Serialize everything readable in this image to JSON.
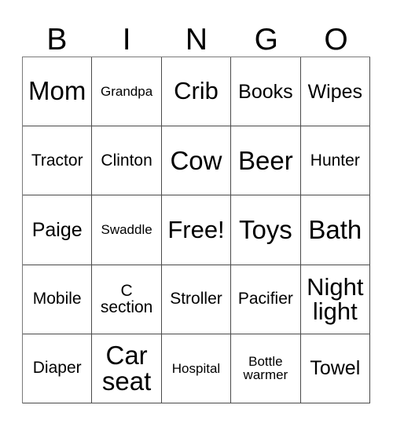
{
  "card": {
    "header_letters": [
      "B",
      "I",
      "N",
      "G",
      "O"
    ],
    "free_space_label": "Free!",
    "colors": {
      "background": "#ffffff",
      "cell_background": "#ffffff",
      "text": "#000000",
      "grid_line": "#4a4a4a",
      "outer_line": "#7a7a7a"
    },
    "rows": [
      [
        {
          "text": "Mom",
          "size": "xl"
        },
        {
          "text": "Grandpa",
          "size": "xs"
        },
        {
          "text": "Crib",
          "size": "lg"
        },
        {
          "text": "Books",
          "size": "md"
        },
        {
          "text": "Wipes",
          "size": "md"
        }
      ],
      [
        {
          "text": "Tractor",
          "size": "sm"
        },
        {
          "text": "Clinton",
          "size": "sm"
        },
        {
          "text": "Cow",
          "size": "xl"
        },
        {
          "text": "Beer",
          "size": "xl"
        },
        {
          "text": "Hunter",
          "size": "sm"
        }
      ],
      [
        {
          "text": "Paige",
          "size": "md"
        },
        {
          "text": "Swaddle",
          "size": "xs"
        },
        {
          "text": "Free!",
          "size": "lg"
        },
        {
          "text": "Toys",
          "size": "xl"
        },
        {
          "text": "Bath",
          "size": "xl"
        }
      ],
      [
        {
          "text": "Mobile",
          "size": "sm"
        },
        {
          "text": "C\nsection",
          "size": "sm",
          "lines": 2
        },
        {
          "text": "Stroller",
          "size": "sm"
        },
        {
          "text": "Pacifier",
          "size": "sm"
        },
        {
          "text": "Night\nlight",
          "size": "lg",
          "lines": 2
        }
      ],
      [
        {
          "text": "Diaper",
          "size": "sm"
        },
        {
          "text": "Car\nseat",
          "size": "xl",
          "lines": 2
        },
        {
          "text": "Hospital",
          "size": "xs"
        },
        {
          "text": "Bottle\nwarmer",
          "size": "xs",
          "lines": 2
        },
        {
          "text": "Towel",
          "size": "md"
        }
      ]
    ]
  }
}
